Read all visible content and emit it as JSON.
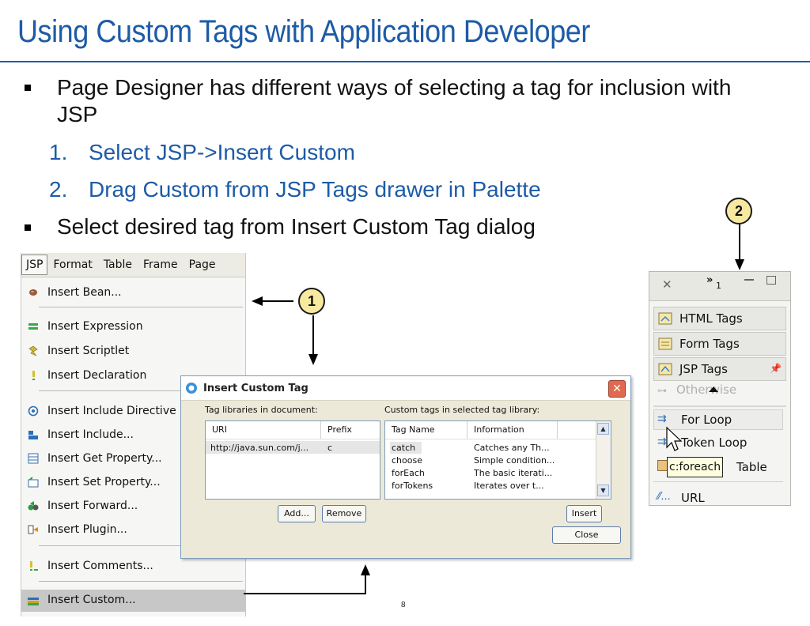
{
  "slide": {
    "title": "Using Custom Tags with Application Developer",
    "bullet1": "Page Designer has different ways of selecting a tag for inclusion with JSP",
    "sub1_num": "1.",
    "sub1": "Select JSP->Insert Custom",
    "sub2_num": "2.",
    "sub2": "Drag Custom from JSP Tags drawer in Palette",
    "bullet2": "Select desired tag from Insert Custom Tag dialog",
    "page_number": "8",
    "accent_color": "#1d5ba6"
  },
  "callouts": {
    "one": "1",
    "two": "2"
  },
  "menu": {
    "bar": [
      "JSP",
      "Format",
      "Table",
      "Frame",
      "Page"
    ],
    "items": [
      {
        "label": "Insert Bean...",
        "icon": "bean-icon"
      },
      {
        "label": "Insert Expression",
        "icon": "expression-icon"
      },
      {
        "label": "Insert Scriptlet",
        "icon": "scriptlet-icon"
      },
      {
        "label": "Insert Declaration",
        "icon": "declaration-icon"
      },
      {
        "label": "Insert Include Directive",
        "icon": "include-directive-icon"
      },
      {
        "label": "Insert Include...",
        "icon": "include-icon"
      },
      {
        "label": "Insert Get Property...",
        "icon": "get-property-icon"
      },
      {
        "label": "Insert Set Property...",
        "icon": "set-property-icon"
      },
      {
        "label": "Insert Forward...",
        "icon": "forward-icon"
      },
      {
        "label": "Insert Plugin...",
        "icon": "plugin-icon"
      },
      {
        "label": "Insert Comments...",
        "icon": "comments-icon"
      },
      {
        "label": "Insert Custom...",
        "icon": "custom-tag-icon"
      }
    ]
  },
  "dialog": {
    "title": "Insert Custom Tag",
    "left_label": "Tag libraries in document:",
    "right_label": "Custom tags in selected tag library:",
    "lib_columns": [
      "URI",
      "Prefix"
    ],
    "lib_rows": [
      {
        "uri": "http://java.sun.com/j...",
        "prefix": "c"
      }
    ],
    "tag_columns": [
      "Tag Name",
      "Information"
    ],
    "tag_rows": [
      {
        "name": "catch",
        "info": "Catches any Th..."
      },
      {
        "name": "choose",
        "info": "Simple condition..."
      },
      {
        "name": "forEach",
        "info": "The basic iterati..."
      },
      {
        "name": "forTokens",
        "info": "Iterates over t..."
      }
    ],
    "buttons": {
      "add": "Add...",
      "remove": "Remove",
      "insert": "Insert",
      "close": "Close"
    }
  },
  "palette": {
    "drawers": [
      "HTML Tags",
      "Form Tags",
      "JSP Tags"
    ],
    "faded_entry": "Otherwise",
    "entries": [
      "For Loop",
      "Token Loop",
      "Table",
      "URL"
    ],
    "tooltip": "c:foreach"
  }
}
